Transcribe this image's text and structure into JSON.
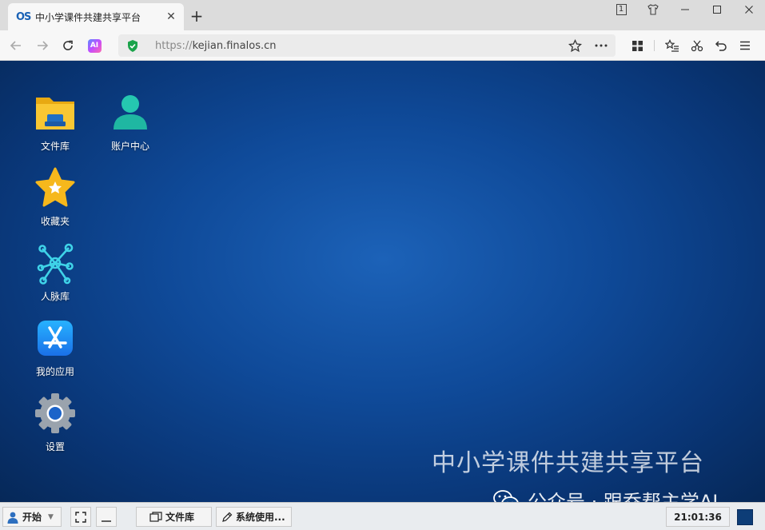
{
  "browser": {
    "tab": {
      "favicon": "OS",
      "title": "中小学课件共建共享平台",
      "close": "✕"
    },
    "new_tab": "+",
    "window_controls": {
      "badge": "1"
    },
    "url": {
      "scheme": "https://",
      "host": "kejian.finalos.cn"
    }
  },
  "desktop": {
    "icons": [
      {
        "label": "文件库",
        "icon": "folder-icon"
      },
      {
        "label": "账户中心",
        "icon": "user-icon"
      },
      {
        "label": "收藏夹",
        "icon": "star-icon"
      },
      {
        "label": "人脉库",
        "icon": "network-icon"
      },
      {
        "label": "我的应用",
        "icon": "app-store-icon"
      },
      {
        "label": "设置",
        "icon": "gear-icon"
      }
    ],
    "watermark": "中小学课件共建共享平台",
    "wechat_mark": "公众号 · 跟乔帮主学AI"
  },
  "taskbar": {
    "start": "开始",
    "tasks": [
      "文件库",
      "系统使用..."
    ],
    "clock": "21:01:36"
  },
  "colors": {
    "desktop_bg": "#0f4a99",
    "accent": "#1a62b5"
  }
}
